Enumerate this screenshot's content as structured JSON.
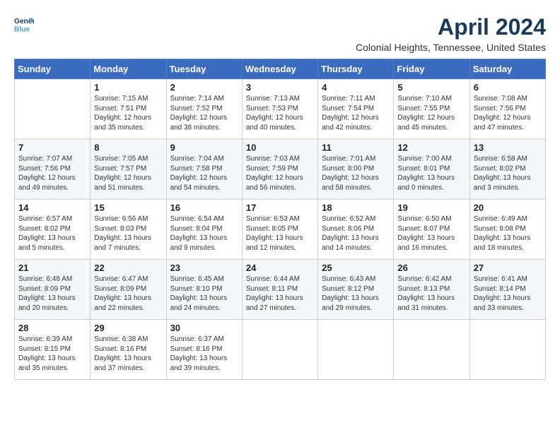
{
  "header": {
    "logo_line1": "General",
    "logo_line2": "Blue",
    "month_title": "April 2024",
    "location": "Colonial Heights, Tennessee, United States"
  },
  "weekdays": [
    "Sunday",
    "Monday",
    "Tuesday",
    "Wednesday",
    "Thursday",
    "Friday",
    "Saturday"
  ],
  "weeks": [
    [
      {
        "day": "",
        "info": ""
      },
      {
        "day": "1",
        "info": "Sunrise: 7:15 AM\nSunset: 7:51 PM\nDaylight: 12 hours\nand 35 minutes."
      },
      {
        "day": "2",
        "info": "Sunrise: 7:14 AM\nSunset: 7:52 PM\nDaylight: 12 hours\nand 38 minutes."
      },
      {
        "day": "3",
        "info": "Sunrise: 7:13 AM\nSunset: 7:53 PM\nDaylight: 12 hours\nand 40 minutes."
      },
      {
        "day": "4",
        "info": "Sunrise: 7:11 AM\nSunset: 7:54 PM\nDaylight: 12 hours\nand 42 minutes."
      },
      {
        "day": "5",
        "info": "Sunrise: 7:10 AM\nSunset: 7:55 PM\nDaylight: 12 hours\nand 45 minutes."
      },
      {
        "day": "6",
        "info": "Sunrise: 7:08 AM\nSunset: 7:56 PM\nDaylight: 12 hours\nand 47 minutes."
      }
    ],
    [
      {
        "day": "7",
        "info": "Sunrise: 7:07 AM\nSunset: 7:56 PM\nDaylight: 12 hours\nand 49 minutes."
      },
      {
        "day": "8",
        "info": "Sunrise: 7:05 AM\nSunset: 7:57 PM\nDaylight: 12 hours\nand 51 minutes."
      },
      {
        "day": "9",
        "info": "Sunrise: 7:04 AM\nSunset: 7:58 PM\nDaylight: 12 hours\nand 54 minutes."
      },
      {
        "day": "10",
        "info": "Sunrise: 7:03 AM\nSunset: 7:59 PM\nDaylight: 12 hours\nand 56 minutes."
      },
      {
        "day": "11",
        "info": "Sunrise: 7:01 AM\nSunset: 8:00 PM\nDaylight: 12 hours\nand 58 minutes."
      },
      {
        "day": "12",
        "info": "Sunrise: 7:00 AM\nSunset: 8:01 PM\nDaylight: 13 hours\nand 0 minutes."
      },
      {
        "day": "13",
        "info": "Sunrise: 6:58 AM\nSunset: 8:02 PM\nDaylight: 13 hours\nand 3 minutes."
      }
    ],
    [
      {
        "day": "14",
        "info": "Sunrise: 6:57 AM\nSunset: 8:02 PM\nDaylight: 13 hours\nand 5 minutes."
      },
      {
        "day": "15",
        "info": "Sunrise: 6:56 AM\nSunset: 8:03 PM\nDaylight: 13 hours\nand 7 minutes."
      },
      {
        "day": "16",
        "info": "Sunrise: 6:54 AM\nSunset: 8:04 PM\nDaylight: 13 hours\nand 9 minutes."
      },
      {
        "day": "17",
        "info": "Sunrise: 6:53 AM\nSunset: 8:05 PM\nDaylight: 13 hours\nand 12 minutes."
      },
      {
        "day": "18",
        "info": "Sunrise: 6:52 AM\nSunset: 8:06 PM\nDaylight: 13 hours\nand 14 minutes."
      },
      {
        "day": "19",
        "info": "Sunrise: 6:50 AM\nSunset: 8:07 PM\nDaylight: 13 hours\nand 16 minutes."
      },
      {
        "day": "20",
        "info": "Sunrise: 6:49 AM\nSunset: 8:08 PM\nDaylight: 13 hours\nand 18 minutes."
      }
    ],
    [
      {
        "day": "21",
        "info": "Sunrise: 6:48 AM\nSunset: 8:09 PM\nDaylight: 13 hours\nand 20 minutes."
      },
      {
        "day": "22",
        "info": "Sunrise: 6:47 AM\nSunset: 8:09 PM\nDaylight: 13 hours\nand 22 minutes."
      },
      {
        "day": "23",
        "info": "Sunrise: 6:45 AM\nSunset: 8:10 PM\nDaylight: 13 hours\nand 24 minutes."
      },
      {
        "day": "24",
        "info": "Sunrise: 6:44 AM\nSunset: 8:11 PM\nDaylight: 13 hours\nand 27 minutes."
      },
      {
        "day": "25",
        "info": "Sunrise: 6:43 AM\nSunset: 8:12 PM\nDaylight: 13 hours\nand 29 minutes."
      },
      {
        "day": "26",
        "info": "Sunrise: 6:42 AM\nSunset: 8:13 PM\nDaylight: 13 hours\nand 31 minutes."
      },
      {
        "day": "27",
        "info": "Sunrise: 6:41 AM\nSunset: 8:14 PM\nDaylight: 13 hours\nand 33 minutes."
      }
    ],
    [
      {
        "day": "28",
        "info": "Sunrise: 6:39 AM\nSunset: 8:15 PM\nDaylight: 13 hours\nand 35 minutes."
      },
      {
        "day": "29",
        "info": "Sunrise: 6:38 AM\nSunset: 8:16 PM\nDaylight: 13 hours\nand 37 minutes."
      },
      {
        "day": "30",
        "info": "Sunrise: 6:37 AM\nSunset: 8:16 PM\nDaylight: 13 hours\nand 39 minutes."
      },
      {
        "day": "",
        "info": ""
      },
      {
        "day": "",
        "info": ""
      },
      {
        "day": "",
        "info": ""
      },
      {
        "day": "",
        "info": ""
      }
    ]
  ]
}
